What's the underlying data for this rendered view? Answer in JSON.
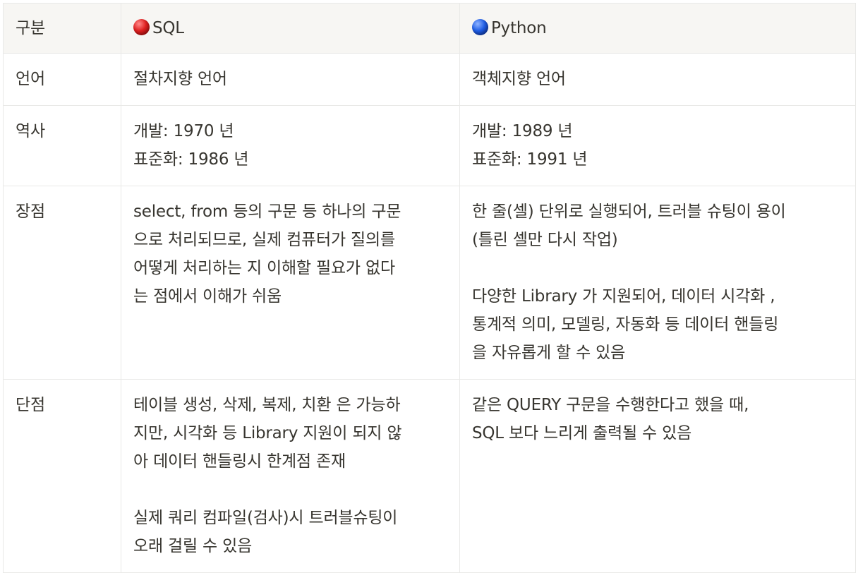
{
  "table": {
    "headers": {
      "category": "구분",
      "sql_icon": "red-circle-icon",
      "sql": "SQL",
      "python_icon": "blue-circle-icon",
      "python": "Python"
    },
    "rows": {
      "language": {
        "label": "언어",
        "sql": [
          "절차지향 언어"
        ],
        "python": [
          "객체지향 언어"
        ]
      },
      "history": {
        "label": "역사",
        "sql": [
          "개발: 1970 년",
          "표준화: 1986 년"
        ],
        "python": [
          "개발: 1989 년",
          "표준화: 1991 년"
        ]
      },
      "pros": {
        "label": "장점",
        "sql": [
          "select, from 등의 구문 등 하나의 구문",
          "으로 처리되므로, 실제 컴퓨터가 질의를",
          "어떻게 처리하는 지 이해할 필요가 없다",
          "는 점에서 이해가 쉬움"
        ],
        "python": [
          "한 줄(셀) 단위로 실행되어, 트러블 슈팅이 용이",
          "(틀린 셀만 다시 작업)",
          "다양한 Library 가 지원되어, 데이터 시각화 ,",
          "통계적 의미, 모델링, 자동화 등 데이터 핸들링",
          "을 자유롭게 할 수 있음"
        ]
      },
      "cons": {
        "label": "단점",
        "sql": [
          "테이블 생성, 삭제, 복제, 치환 은 가능하",
          "지만, 시각화 등 Library 지원이 되지 않",
          "아 데이터 핸들링시 한계점 존재",
          "실제 쿼리 컴파일(검사)시 트러블슈팅이",
          "오래 걸릴 수 있음"
        ],
        "python": [
          "같은 QUERY 구문을 수행한다고 했을 때,",
          "SQL 보다 느리게 출력될 수 있음"
        ]
      }
    }
  },
  "colors": {
    "header_bg": "#f7f6f3",
    "border": "#e9e9e7",
    "text": "#37352f",
    "sql_dot": "#e02020",
    "python_dot": "#1f5ee6"
  }
}
